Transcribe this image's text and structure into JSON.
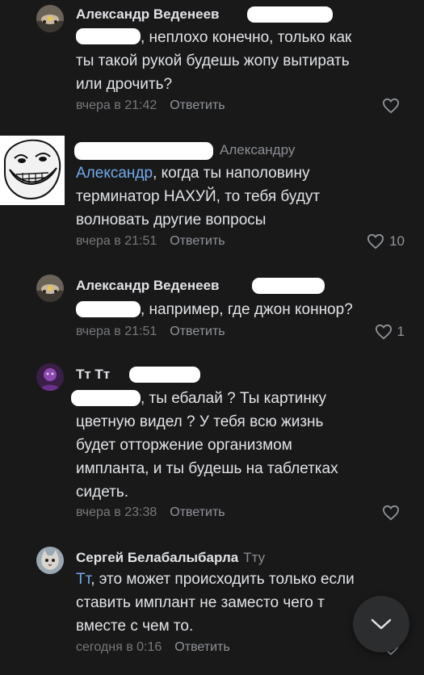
{
  "colors": {
    "background": "#19191a",
    "text": "#e1e3e6",
    "secondary": "#76787a",
    "mention": "#71aaeb",
    "fab": "#2c2d2e"
  },
  "comments": [
    {
      "author": "Александр Веденеев",
      "lines": [
        ", неплохо конечно, только как",
        "ты такой рукой будешь жопу вытирать",
        "или дрочить?"
      ],
      "time": "вчера в 21:42",
      "reply_label": "Ответить",
      "likes": "",
      "avatar": "car-photo-avatar",
      "like_icon": "heart-icon"
    },
    {
      "reply_to": "Александру",
      "mention": "Александр",
      "lines": [
        ", когда ты наполовину",
        "терминатор  НАХУЙ, то тебя будут",
        "волновать другие вопросы"
      ],
      "time": "вчера в 21:51",
      "reply_label": "Ответить",
      "likes": "10",
      "avatar": "trollface-avatar",
      "like_icon": "heart-icon"
    },
    {
      "author": "Александр Веденеев",
      "lines": [
        ", например, где джон коннор?"
      ],
      "time": "вчера в 21:51",
      "reply_label": "Ответить",
      "likes": "1",
      "avatar": "car-photo-avatar",
      "like_icon": "heart-icon"
    },
    {
      "author": "Тт Тт",
      "lines": [
        ", ты ебалай ? Ты картинку",
        "цветную видел ? У тебя всю жизнь",
        "будет отторжение организмом",
        "импланта, и ты будешь на таблетках",
        "сидеть."
      ],
      "time": "вчера в 23:38",
      "reply_label": "Ответить",
      "likes": "",
      "avatar": "purple-photo-avatar",
      "like_icon": "heart-icon"
    },
    {
      "author": "Сергей Белабалыбарла",
      "reply_to": "Тту",
      "mention": "Тт",
      "lines": [
        ", это может происходить только если",
        "ставить имплант не заместо чего т",
        "вместе с чем то."
      ],
      "time": "сегодня в 0:16",
      "reply_label": "Ответить",
      "likes": "",
      "avatar": "cat-photo-avatar",
      "like_icon": "heart-icon"
    }
  ],
  "fab": {
    "icon": "chevron-down-icon"
  }
}
